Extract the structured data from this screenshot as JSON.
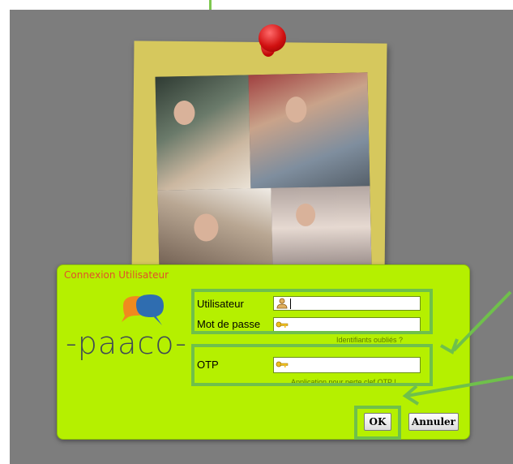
{
  "dialog": {
    "title": "Connexion Utilisateur",
    "brand": "-paaco-",
    "username_label": "Utilisateur",
    "password_label": "Mot de passe",
    "otp_label": "OTP",
    "forgot_hint": "Identifiants oubliés ?",
    "otp_hint": "Application pour perte clef OTP !",
    "ok_label": "OK",
    "cancel_label": "Annuler"
  },
  "colors": {
    "dialog_background": "#b5f000",
    "title": "#e0502a",
    "highlight": "#6fc04b",
    "screen": "#7d7d7d"
  },
  "icons": [
    "user-icon",
    "key-icon",
    "pushpin-icon",
    "chat-bubbles-logo"
  ]
}
